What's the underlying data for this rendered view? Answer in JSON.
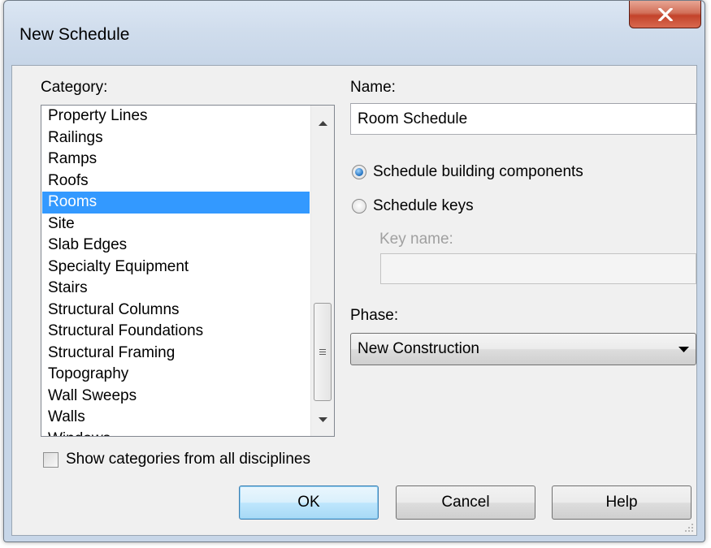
{
  "window": {
    "title": "New Schedule"
  },
  "category": {
    "label": "Category:",
    "items": [
      "Property Lines",
      "Railings",
      "Ramps",
      "Roofs",
      "Rooms",
      "Site",
      "Slab Edges",
      "Specialty Equipment",
      "Stairs",
      "Structural Columns",
      "Structural Foundations",
      "Structural Framing",
      "Topography",
      "Wall Sweeps",
      "Walls",
      "Windows"
    ],
    "selected": "Rooms",
    "show_all_label": "Show categories from all disciplines",
    "show_all_checked": false
  },
  "name": {
    "label": "Name:",
    "value": "Room Schedule"
  },
  "schedule_type": {
    "building_components_label": "Schedule building components",
    "keys_label": "Schedule keys",
    "selected": "building_components",
    "key_name_label": "Key name:",
    "key_name_value": ""
  },
  "phase": {
    "label": "Phase:",
    "value": "New Construction"
  },
  "buttons": {
    "ok": "OK",
    "cancel": "Cancel",
    "help": "Help"
  },
  "icons": {
    "close": "close-icon",
    "scroll_up": "scroll-up-arrow-icon",
    "scroll_down": "scroll-down-arrow-icon",
    "dropdown": "chevron-down-icon"
  },
  "colors": {
    "selection": "#3399ff",
    "close_button": "#c3432b",
    "radio_checked": "#1f6fbe"
  }
}
